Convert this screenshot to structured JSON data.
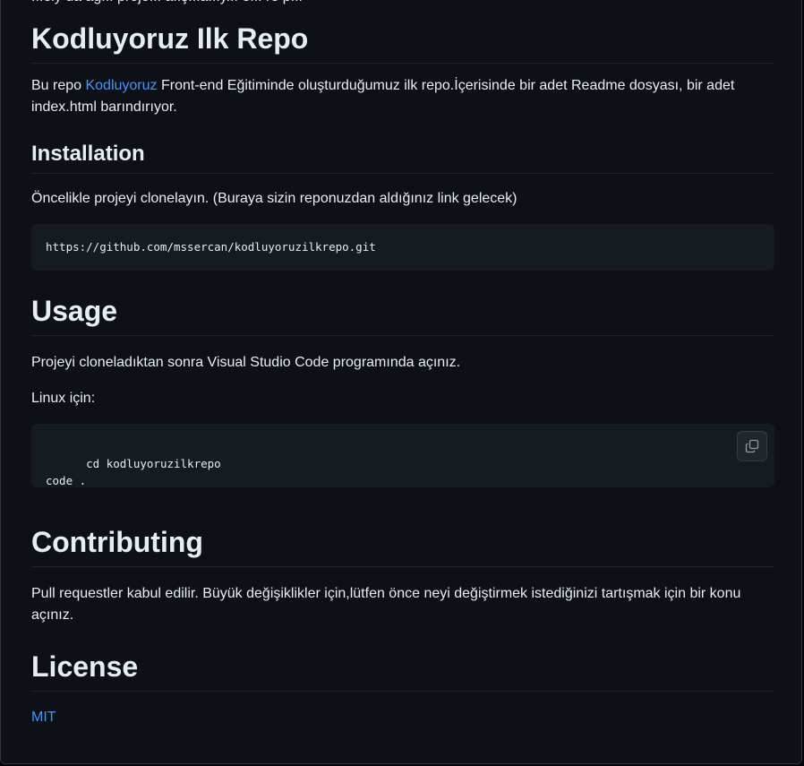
{
  "readme": {
    "clipped_top_text": "...ely da ag... proje... a..ş...a...y... e... re p...",
    "title": "Kodluyoruz Ilk Repo",
    "intro": {
      "prefix": "Bu repo ",
      "link_text": "Kodluyoruz",
      "suffix": " Front-end Eğitiminde oluşturduğumuz ilk repo.İçerisinde bir adet Readme dosyası, bir adet index.html barındırıyor."
    },
    "installation": {
      "heading": "Installation",
      "text": "Öncelikle projeyi clonelayın. (Buraya sizin reponuzdan aldığınız link gelecek)",
      "code": "https://github.com/mssercan/kodluyoruzilkrepo.git"
    },
    "usage": {
      "heading": "Usage",
      "text": "Projeyi cloneladıktan sonra Visual Studio Code programında açınız.",
      "linux_label": "Linux için:",
      "code": "cd kodluyoruzilkrepo\ncode .",
      "copy_icon": "copy-icon"
    },
    "contributing": {
      "heading": "Contributing",
      "text": "Pull requestler kabul edilir. Büyük değişiklikler için,lütfen önce neyi değiştirmek istediğinizi tartışmak için bir konu açınız."
    },
    "license": {
      "heading": "License",
      "link_text": "MIT"
    }
  },
  "colors": {
    "background": "#0d1117",
    "text": "#e6edf3",
    "link": "#4493f8",
    "code_bg": "#161b22",
    "border": "#21262d"
  }
}
